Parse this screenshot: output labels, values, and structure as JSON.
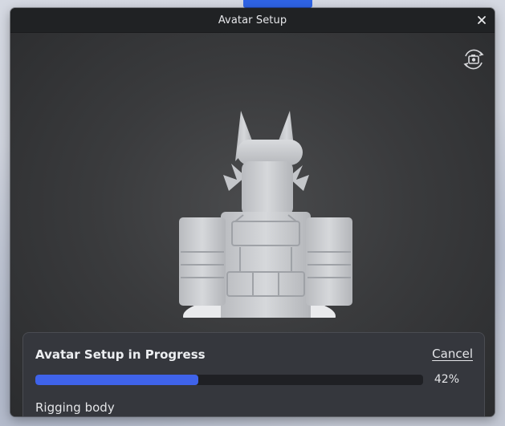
{
  "window": {
    "title": "Avatar Setup",
    "close_icon": "close-icon"
  },
  "viewport": {
    "camera_icon": "camera-rotate-icon"
  },
  "progress": {
    "title": "Avatar Setup in Progress",
    "cancel_label": "Cancel",
    "value": 0.42,
    "percent_text": "42%",
    "status": "Rigging body",
    "fill_color": "#3f63ea",
    "track_color": "#1f2024"
  }
}
